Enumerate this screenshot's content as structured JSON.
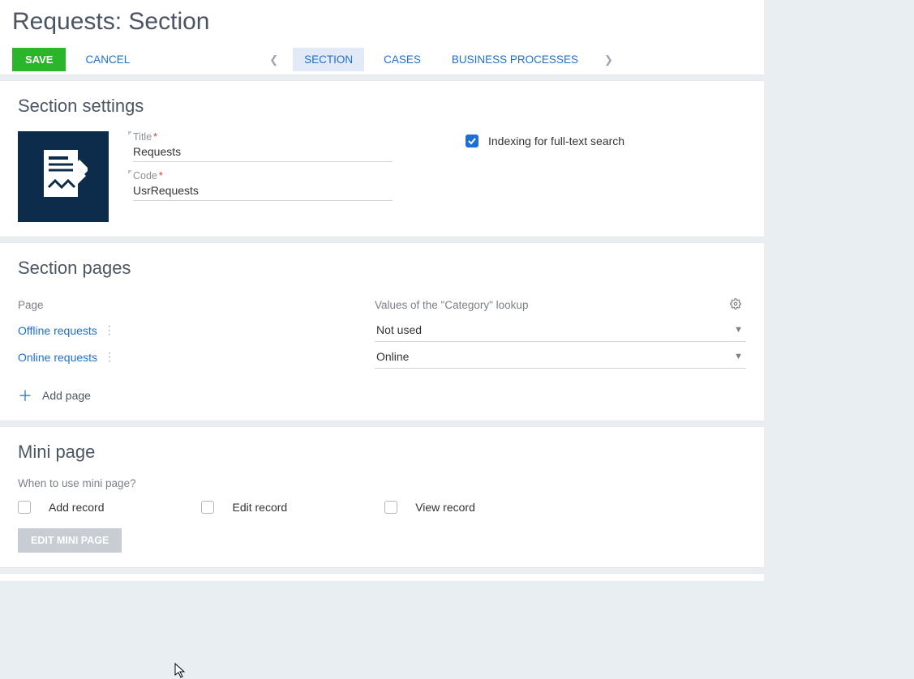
{
  "header": {
    "pageTitle": "Requests: Section",
    "saveLabel": "SAVE",
    "cancelLabel": "CANCEL",
    "tabs": [
      "SECTION",
      "CASES",
      "BUSINESS PROCESSES"
    ],
    "activeTab": 0
  },
  "sectionSettings": {
    "title": "Section settings",
    "fields": {
      "titleLabel": "Title",
      "titleValue": "Requests",
      "codeLabel": "Code",
      "codeValue": "UsrRequests"
    },
    "indexing": {
      "label": "Indexing for full-text search",
      "checked": true
    }
  },
  "sectionPages": {
    "title": "Section pages",
    "cols": {
      "page": "Page",
      "lookup": "Values of the \"Category\" lookup"
    },
    "rows": [
      {
        "page": "Offline requests",
        "lookup": "Not used"
      },
      {
        "page": "Online requests",
        "lookup": "Online"
      }
    ],
    "addPage": "Add page"
  },
  "miniPage": {
    "title": "Mini page",
    "question": "When to use mini page?",
    "options": [
      {
        "label": "Add record",
        "checked": false
      },
      {
        "label": "Edit record",
        "checked": false
      },
      {
        "label": "View record",
        "checked": false
      }
    ],
    "editBtn": "EDIT MINI PAGE"
  }
}
